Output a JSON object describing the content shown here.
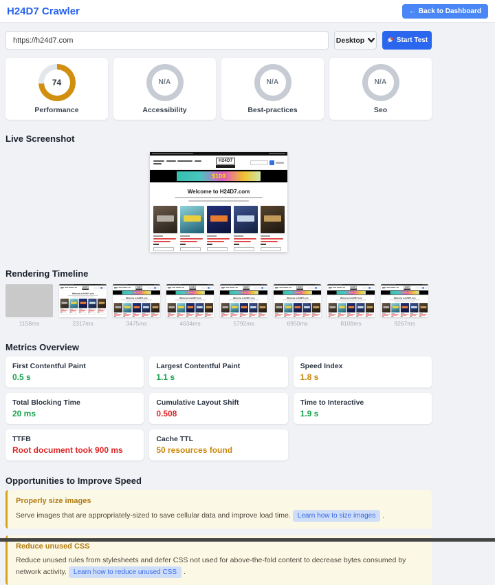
{
  "header": {
    "title": "H24D7 Crawler",
    "back_icon": "←",
    "back_label": "Back to Dashboard"
  },
  "controls": {
    "url_value": "https://h24d7.com",
    "device_selected": "Desktop",
    "start_label": "Start Test"
  },
  "scores": [
    {
      "label": "Performance",
      "value": "74",
      "percent": 74
    },
    {
      "label": "Accessibility",
      "value": "N/A",
      "percent": null
    },
    {
      "label": "Best-practices",
      "value": "N/A",
      "percent": null
    },
    {
      "label": "Seo",
      "value": "N/A",
      "percent": null
    }
  ],
  "sections": {
    "live_screenshot": "Live Screenshot",
    "rendering_timeline": "Rendering Timeline",
    "metrics_overview": "Metrics Overview",
    "opportunities": "Opportunities to Improve Speed"
  },
  "live_screenshot": {
    "logo": "H24D7",
    "banner_amount": "$100",
    "welcome": "Welcome to H24D7.com",
    "cover_colors": [
      [
        "#6b5a4a",
        "#26201a",
        "#b8b4ac"
      ],
      [
        "#8fd4da",
        "#1d5e74",
        "#f2d23a"
      ],
      [
        "#23307a",
        "#0c1238",
        "#f07f2e"
      ],
      [
        "#3d548f",
        "#141f3e",
        "#cfe0f0"
      ],
      [
        "#57442f",
        "#1e1610",
        "#c9a15e"
      ]
    ]
  },
  "timeline": [
    {
      "time": "1158ms",
      "variant": "blank"
    },
    {
      "time": "2317ms",
      "variant": "nobanner"
    },
    {
      "time": "3475ms",
      "variant": "full"
    },
    {
      "time": "4634ms",
      "variant": "full"
    },
    {
      "time": "5792ms",
      "variant": "full"
    },
    {
      "time": "6950ms",
      "variant": "full"
    },
    {
      "time": "8109ms",
      "variant": "full"
    },
    {
      "time": "9267ms",
      "variant": "full"
    }
  ],
  "metrics": [
    {
      "label": "First Contentful Paint",
      "value": "0.5 s",
      "status": "good"
    },
    {
      "label": "Largest Contentful Paint",
      "value": "1.1 s",
      "status": "good"
    },
    {
      "label": "Speed Index",
      "value": "1.8 s",
      "status": "warn"
    },
    {
      "label": "Total Blocking Time",
      "value": "20 ms",
      "status": "good"
    },
    {
      "label": "Cumulative Layout Shift",
      "value": "0.508",
      "status": "bad"
    },
    {
      "label": "Time to Interactive",
      "value": "1.9 s",
      "status": "good"
    },
    {
      "label": "TTFB",
      "value": "Root document took 900 ms",
      "status": "bad"
    },
    {
      "label": "Cache TTL",
      "value": "50 resources found",
      "status": "warn"
    }
  ],
  "opportunities": [
    {
      "title": "Properly size images",
      "description": "Serve images that are appropriately-sized to save cellular data and improve load time.",
      "link_label": "Learn how to size images",
      "suffix": "."
    },
    {
      "title": "Reduce unused CSS",
      "description": "Reduce unused rules from stylesheets and defer CSS not used for above-the-fold content to decrease bytes consumed by network activity.",
      "link_label": "Learn how to reduce unused CSS",
      "suffix": "."
    }
  ],
  "colors": {
    "accent": "#2563eb",
    "ring_fill": "#d18f0f",
    "ring_track": "#e3e6eb",
    "ring_na": "#c7ccd4",
    "status": {
      "good": "#16a34a",
      "warn": "#c8880f",
      "bad": "#dc2626"
    }
  }
}
